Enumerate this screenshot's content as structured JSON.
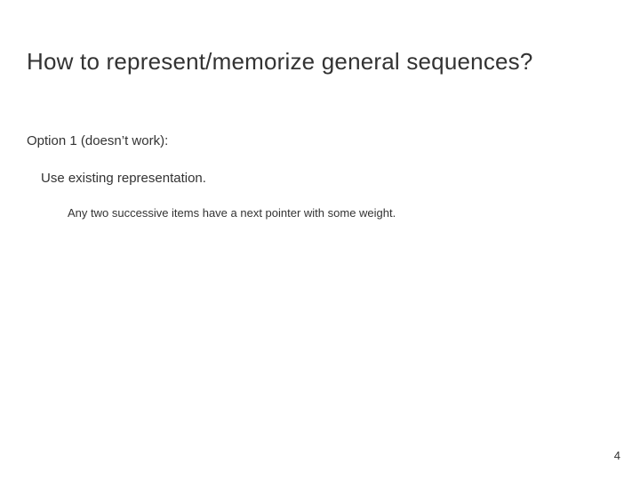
{
  "slide": {
    "title": "How to represent/memorize general sequences?",
    "option_label": "Option 1 (doesn’t work):",
    "option_desc": "Use existing representation.",
    "detail_line": "Any two successive items have a next pointer with some weight.",
    "page_number": "4"
  }
}
